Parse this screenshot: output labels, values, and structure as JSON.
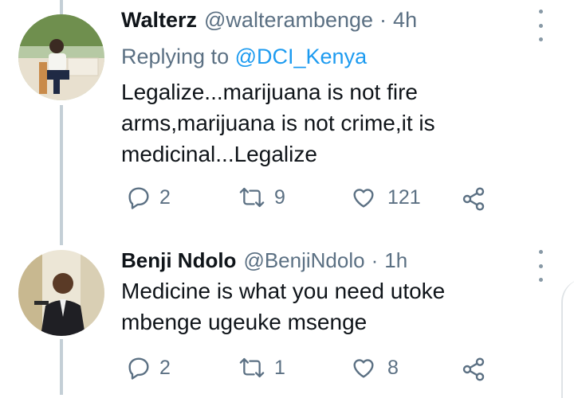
{
  "tweets": [
    {
      "display_name": "Walterz",
      "handle": "@walterambenge",
      "time": "4h",
      "replying_prefix": "Replying to",
      "replying_to": "@DCI_Kenya",
      "text": "Legalize...marijuana is not fire arms,marijuana is not crime,it is medicinal...Legalize",
      "stats": {
        "replies": "2",
        "retweets": "9",
        "likes": "121"
      }
    },
    {
      "display_name": "Benji Ndolo",
      "handle": "@BenjiNdolo",
      "time": "1h",
      "text": "Medicine is what you need utoke mbenge ugeuke msenge",
      "stats": {
        "replies": "2",
        "retweets": "1",
        "likes": "8"
      }
    }
  ],
  "separator": "·",
  "colors": {
    "text": "#0f1419",
    "muted": "#5b7083",
    "link": "#1d9bf0",
    "thread": "#c4cfd6"
  },
  "icons": [
    "more-vertical-icon",
    "reply-icon",
    "retweet-icon",
    "like-icon",
    "share-icon"
  ]
}
